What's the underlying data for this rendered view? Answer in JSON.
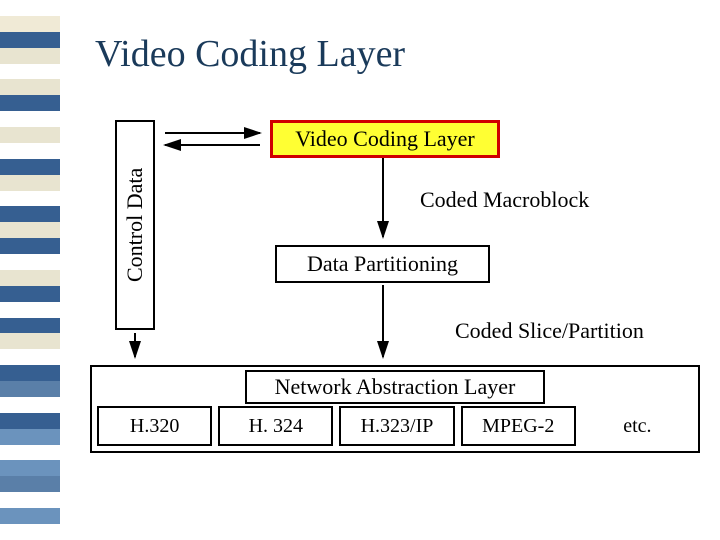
{
  "title": "Video Coding Layer",
  "sidebar_colors": [
    "#ffffff",
    "#f0ead6",
    "#365f91",
    "#e8e4d0",
    "#ffffff",
    "#e8e4d0",
    "#365f91",
    "#ffffff",
    "#e8e4d0",
    "#ffffff",
    "#365f91",
    "#e8e4d0",
    "#ffffff",
    "#365f91",
    "#e8e4d0",
    "#365f91",
    "#ffffff",
    "#e8e4d0",
    "#365f91",
    "#ffffff",
    "#365f91",
    "#e8e4d0",
    "#ffffff",
    "#365f91",
    "#5a7fa8",
    "#ffffff",
    "#365f91",
    "#6b93bd",
    "#ffffff",
    "#6b93bd",
    "#5a7fa8",
    "#ffffff",
    "#6b93bd",
    "#ffffff"
  ],
  "diagram": {
    "control_data": "Control Data",
    "video_coding_layer": "Video Coding Layer",
    "coded_macroblock": "Coded Macroblock",
    "data_partitioning": "Data Partitioning",
    "coded_slice_partition": "Coded Slice/Partition",
    "network_abstraction_layer": "Network Abstraction Layer",
    "nal_items": {
      "h320": "H.320",
      "h324": "H. 324",
      "h323ip": "H.323/IP",
      "mpeg2": "MPEG-2",
      "etc": "etc."
    }
  }
}
